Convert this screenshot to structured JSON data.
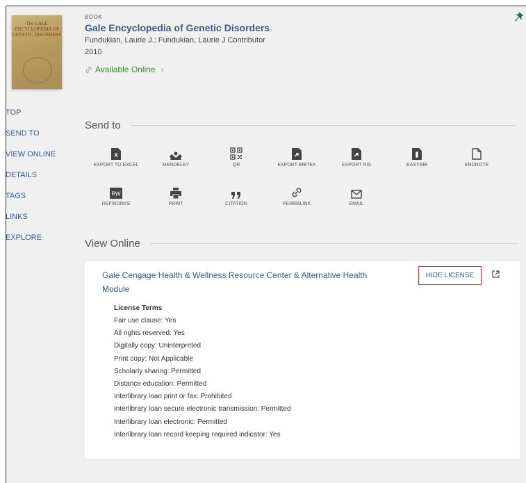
{
  "record": {
    "type": "BOOK",
    "title": "Gale Encyclopedia of Genetic Disorders",
    "authors": "Fundukian, Laurie J.; Fundukian, Laurie J Contributor",
    "year": "2010",
    "availability": "Available Online",
    "cover_text": "The GALE ENCYCLOPEDIA OF GENETIC DISORDERS"
  },
  "nav": {
    "items": [
      "TOP",
      "SEND TO",
      "VIEW ONLINE",
      "DETAILS",
      "TAGS",
      "LINKS",
      "EXPLORE"
    ]
  },
  "send_to": {
    "heading": "Send to",
    "actions": [
      {
        "label": "EXPORT TO EXCEL",
        "icon": "excel-icon"
      },
      {
        "label": "MENDELEY",
        "icon": "mendeley-icon"
      },
      {
        "label": "QR",
        "icon": "qr-icon"
      },
      {
        "label": "EXPORT BIBTEX",
        "icon": "bibtex-icon"
      },
      {
        "label": "EXPORT RIS",
        "icon": "ris-icon"
      },
      {
        "label": "EASYBIB",
        "icon": "easybib-icon"
      },
      {
        "label": "ENDNOTE",
        "icon": "endnote-icon"
      },
      {
        "label": "REFWORKS",
        "icon": "refworks-icon"
      },
      {
        "label": "PRINT",
        "icon": "print-icon"
      },
      {
        "label": "CITATION",
        "icon": "citation-icon"
      },
      {
        "label": "PERMALINK",
        "icon": "permalink-icon"
      },
      {
        "label": "EMAIL",
        "icon": "email-icon"
      }
    ]
  },
  "view_online": {
    "heading": "View Online",
    "service_title": "Gale Cengage Health & Wellness Resource Center & Alternative Health Module",
    "hide_license": "HIDE LICENSE",
    "license_heading": "License Terms",
    "license_terms": [
      "Fair use clause: Yes",
      "All rights reserved: Yes",
      "Digitally copy: Uninterpreted",
      "Print copy: Not Applicable",
      "Scholarly sharing: Permitted",
      "Distance education: Permitted",
      "Interlibrary loan print or fax: Prohibited",
      "Interlibrary loan secure electronic transmission: Permitted",
      "Interlibrary loan electronic: Permitted",
      "Interlibrary loan record keeping required indicator: Yes"
    ]
  },
  "colors": {
    "link": "#3a5a8c",
    "available": "#3d8a2e",
    "highlight_border": "#dd3333",
    "background": "#f0f0f0"
  }
}
